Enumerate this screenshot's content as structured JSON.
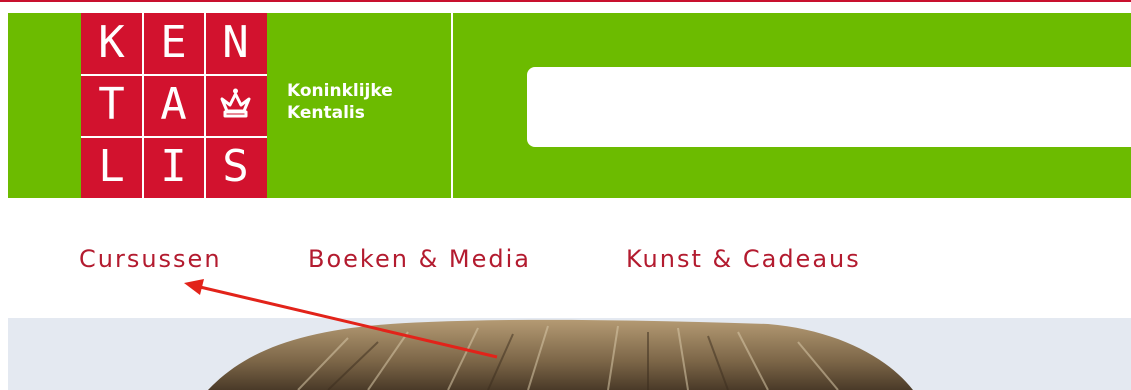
{
  "logo": {
    "letters": [
      "K",
      "E",
      "N",
      "T",
      "A",
      "♛",
      "L",
      "I",
      "S"
    ],
    "alt_name": "Kentalis"
  },
  "brand": {
    "line1": "Koninklijke",
    "line2": "Kentalis"
  },
  "search": {
    "value": "",
    "placeholder": ""
  },
  "nav": {
    "items": [
      {
        "label": "Cursussen"
      },
      {
        "label": "Boeken & Media"
      },
      {
        "label": "Kunst & Cadeaus"
      }
    ]
  },
  "colors": {
    "brand_green": "#6cbb00",
    "logo_red": "#d2122e",
    "nav_red": "#b31b2f",
    "annotation_red": "#e2231a"
  },
  "annotation": {
    "type": "arrow",
    "target": "Cursussen"
  }
}
